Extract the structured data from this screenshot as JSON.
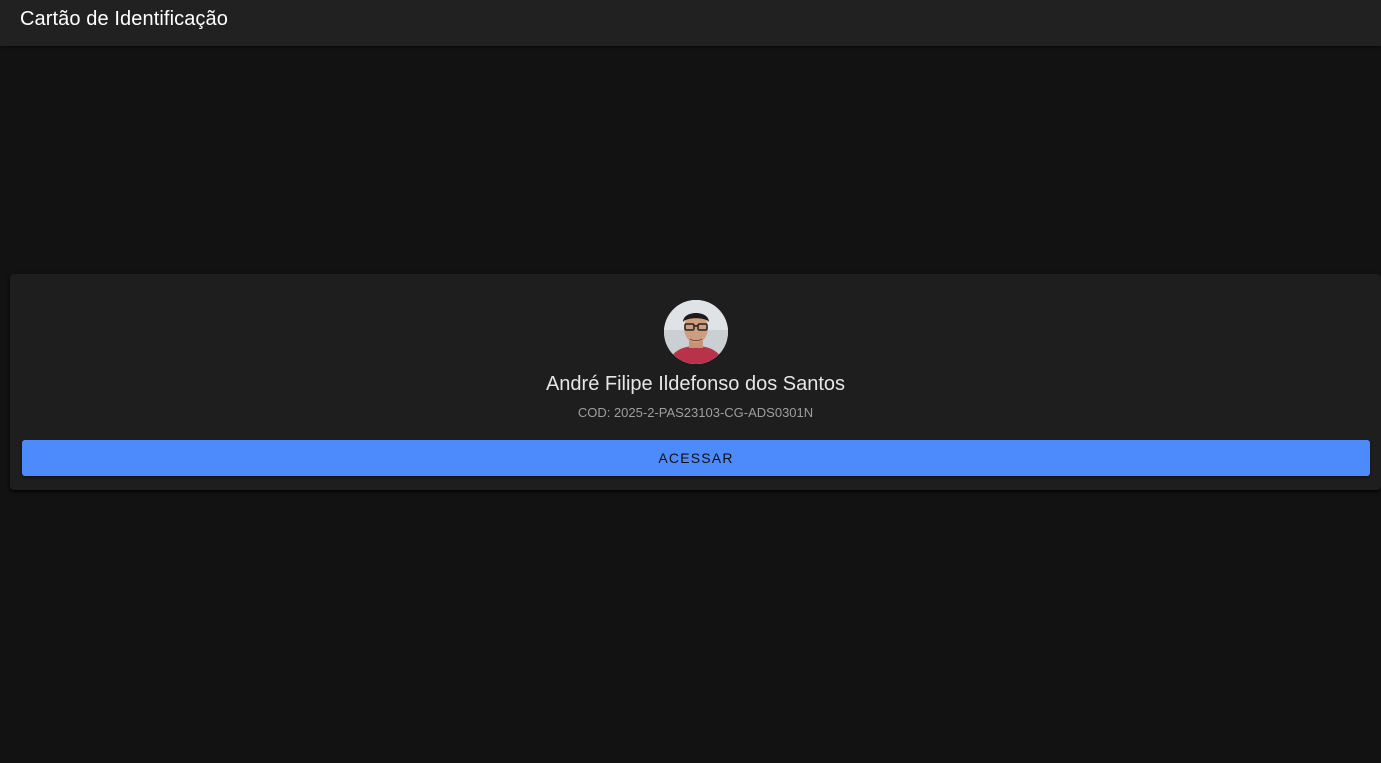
{
  "app_bar": {
    "title": "Cartão de Identificação"
  },
  "card": {
    "avatar_icon": "profile-photo",
    "name": "André Filipe Ildefonso dos Santos",
    "code": "COD: 2025-2-PAS23103-CG-ADS0301N",
    "access_button_label": "ACESSAR"
  },
  "colors": {
    "background": "#121212",
    "app_bar": "#212121",
    "card": "#1e1e1e",
    "accent": "#4d8bfc"
  }
}
